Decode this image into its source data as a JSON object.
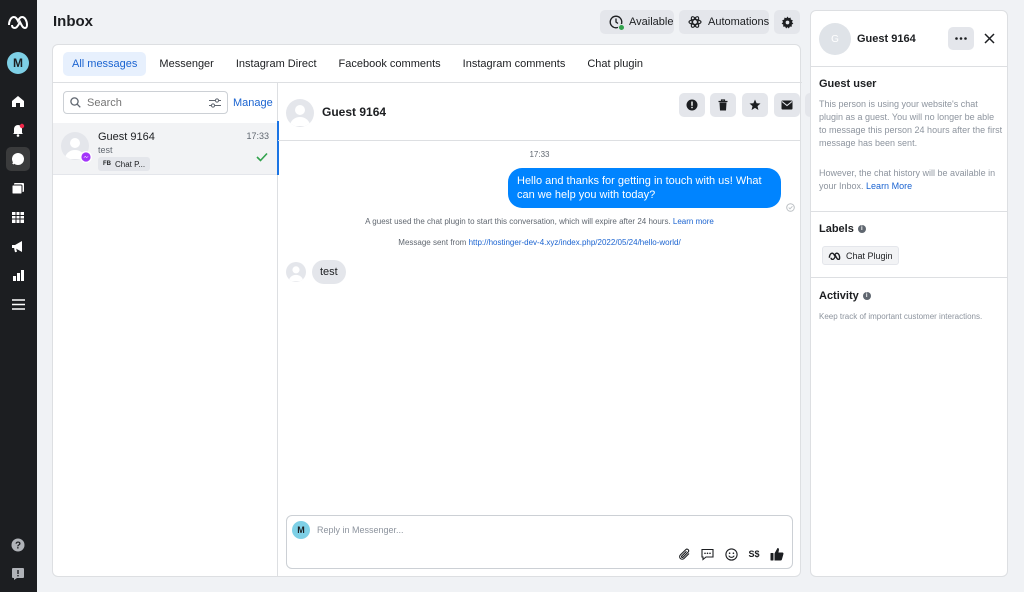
{
  "leftnav": {
    "avatar_letter": "M"
  },
  "header": {
    "title": "Inbox",
    "available_label": "Available",
    "automations_label": "Automations"
  },
  "tabs": [
    {
      "label": "All messages"
    },
    {
      "label": "Messenger"
    },
    {
      "label": "Instagram Direct"
    },
    {
      "label": "Facebook comments"
    },
    {
      "label": "Instagram comments"
    },
    {
      "label": "Chat plugin"
    }
  ],
  "list": {
    "search_placeholder": "Search",
    "manage_label": "Manage",
    "conversation": {
      "name": "Guest 9164",
      "time": "17:33",
      "snippet": "test",
      "tag_prefix": "FB",
      "tag_label": "Chat P..."
    }
  },
  "chat": {
    "name": "Guest 9164",
    "time": "17:33",
    "outgoing_message": "Hello and thanks for getting in touch with us! What can we help you with today?",
    "system_line_1": "A guest used the chat plugin to start this conversation, which will expire after 24 hours.",
    "system_line_1_link": "Learn more",
    "system_line_2": "Message sent from",
    "system_line_2_link": "http://hostinger-dev-4.xyz/index.php/2022/05/24/hello-world/",
    "incoming_message": "test",
    "composer_placeholder": "Reply in Messenger...",
    "composer_avatar_letter": "M",
    "currency_label": "S$"
  },
  "right_panel": {
    "avatar_letter": "G",
    "name": "Guest 9164",
    "guest_title": "Guest user",
    "guest_text": "This person is using your website's chat plugin as a guest. You will no longer be able to message this person 24 hours after the first message has been sent.",
    "history_text": "However, the chat history will be available in your Inbox.",
    "history_link": "Learn More",
    "labels_title": "Labels",
    "label_chip": "Chat Plugin",
    "activity_title": "Activity",
    "activity_text": "Keep track of important customer interactions."
  },
  "colors": {
    "accent": "#1b74e4",
    "bubble_out": "#0084ff",
    "available_dot": "#31a24c",
    "check": "#31a24c"
  }
}
